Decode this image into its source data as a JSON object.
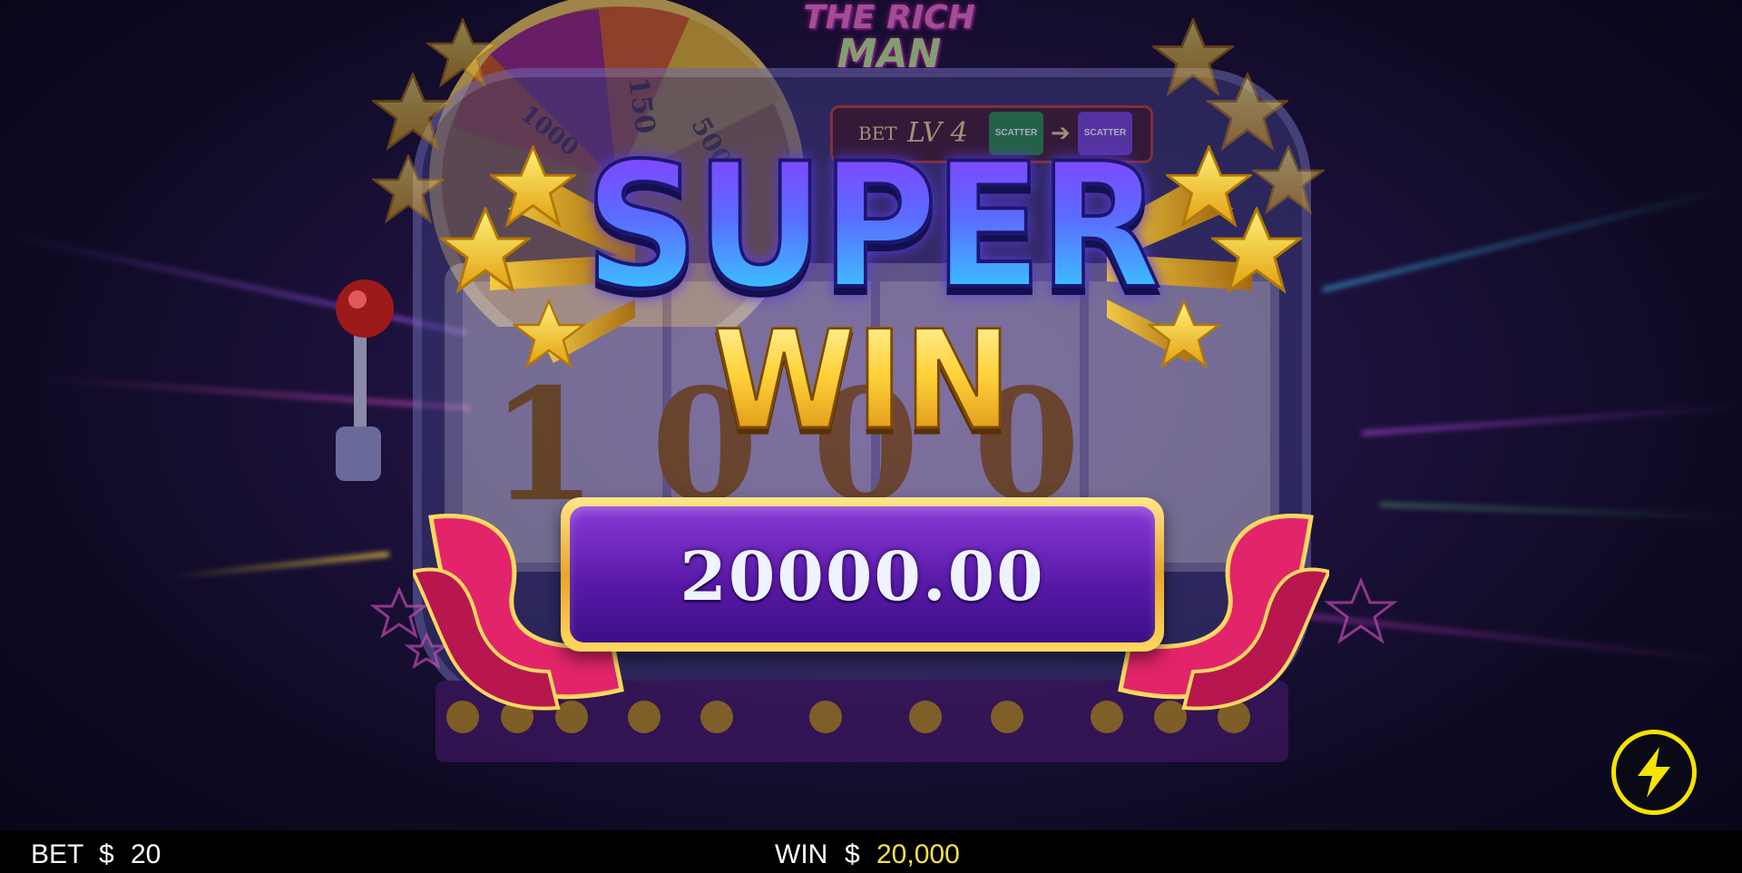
{
  "game": {
    "logo_line1": "THE RICH",
    "logo_line2": "MAN"
  },
  "background_machine": {
    "bet_label": "BET",
    "level_label": "LV 4",
    "scatter_label": "SCATTER",
    "wheel_values": [
      "1000",
      "150",
      "500"
    ],
    "reel_digits": "1 0 0 0"
  },
  "win_banner": {
    "title_top": "SUPER",
    "title_bottom": "WIN",
    "amount": "20000.00"
  },
  "status_bar": {
    "bet_label": "BET",
    "bet_currency": "$",
    "bet_value": "20",
    "win_label": "WIN",
    "win_currency": "$",
    "win_value": "20,000"
  },
  "colors": {
    "win_value": "#f4e04a",
    "bolt_ring": "#f5e400",
    "status_bar_bg": "#000000"
  },
  "icons": {
    "turbo": "lightning-bolt-icon",
    "star": "star-icon"
  }
}
